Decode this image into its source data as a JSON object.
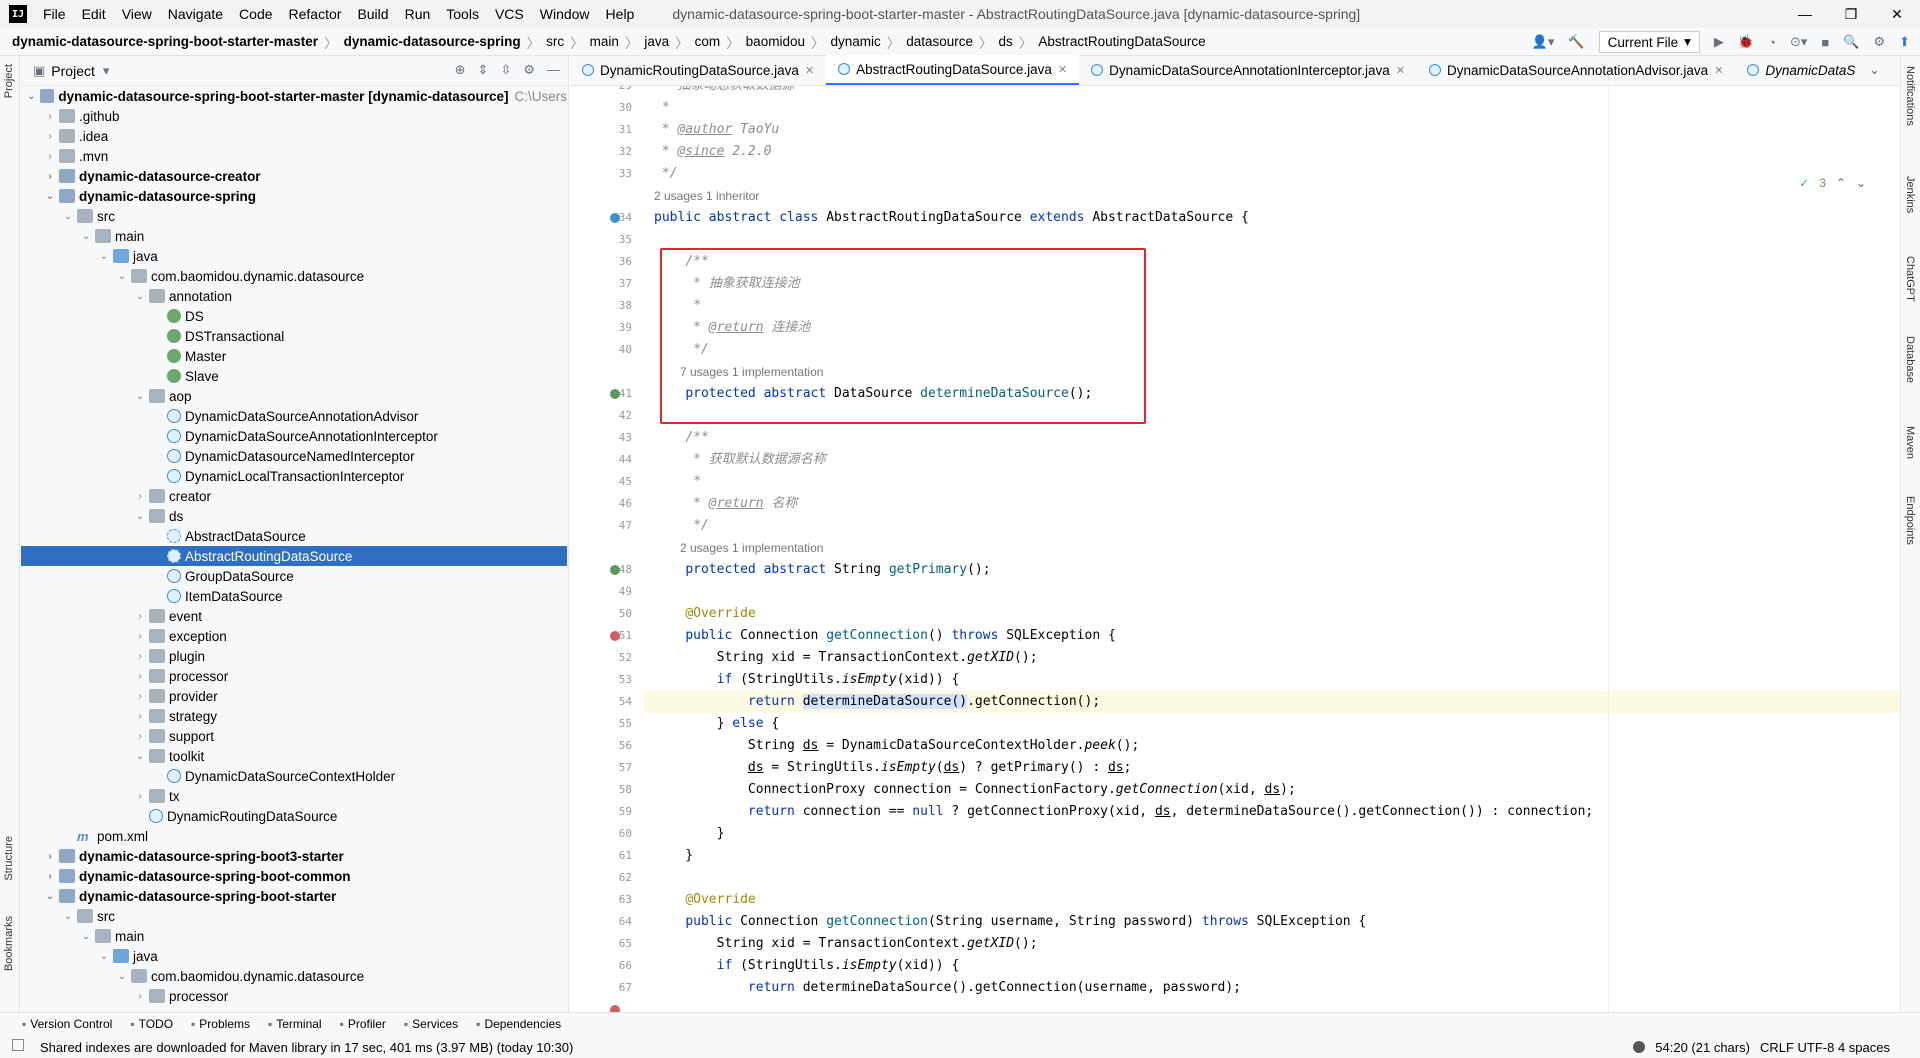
{
  "menubar": {
    "items": [
      "File",
      "Edit",
      "View",
      "Navigate",
      "Code",
      "Refactor",
      "Build",
      "Run",
      "Tools",
      "VCS",
      "Window",
      "Help"
    ],
    "title": "dynamic-datasource-spring-boot-starter-master - AbstractRoutingDataSource.java [dynamic-datasource-spring]"
  },
  "navbar": {
    "crumbs": [
      "dynamic-datasource-spring-boot-starter-master",
      "dynamic-datasource-spring",
      "src",
      "main",
      "java",
      "com",
      "baomidou",
      "dynamic",
      "datasource",
      "ds",
      "AbstractRoutingDataSource"
    ],
    "run_config": "Current File"
  },
  "project": {
    "title": "Project",
    "root": "dynamic-datasource-spring-boot-starter-master [dynamic-datasource]",
    "root_path": "C:\\Users"
  },
  "tree": [
    {
      "label": ".github",
      "type": "folder",
      "level": 1,
      "arrow": "›"
    },
    {
      "label": ".idea",
      "type": "folder",
      "level": 1,
      "arrow": "›"
    },
    {
      "label": ".mvn",
      "type": "folder",
      "level": 1,
      "arrow": "›"
    },
    {
      "label": "dynamic-datasource-creator",
      "type": "module",
      "level": 1,
      "arrow": "›",
      "bold": true
    },
    {
      "label": "dynamic-datasource-spring",
      "type": "module",
      "level": 1,
      "arrow": "⌄",
      "bold": true
    },
    {
      "label": "src",
      "type": "folder",
      "level": 2,
      "arrow": "⌄"
    },
    {
      "label": "main",
      "type": "folder",
      "level": 3,
      "arrow": "⌄"
    },
    {
      "label": "java",
      "type": "folderblue",
      "level": 4,
      "arrow": "⌄"
    },
    {
      "label": "com.baomidou.dynamic.datasource",
      "type": "folder",
      "level": 5,
      "arrow": "⌄"
    },
    {
      "label": "annotation",
      "type": "folder",
      "level": 6,
      "arrow": "⌄"
    },
    {
      "label": "DS",
      "type": "anno",
      "level": 7,
      "arrow": ""
    },
    {
      "label": "DSTransactional",
      "type": "anno",
      "level": 7,
      "arrow": ""
    },
    {
      "label": "Master",
      "type": "anno",
      "level": 7,
      "arrow": ""
    },
    {
      "label": "Slave",
      "type": "anno",
      "level": 7,
      "arrow": ""
    },
    {
      "label": "aop",
      "type": "folder",
      "level": 6,
      "arrow": "⌄"
    },
    {
      "label": "DynamicDataSourceAnnotationAdvisor",
      "type": "class",
      "level": 7,
      "arrow": ""
    },
    {
      "label": "DynamicDataSourceAnnotationInterceptor",
      "type": "class",
      "level": 7,
      "arrow": ""
    },
    {
      "label": "DynamicDatasourceNamedInterceptor",
      "type": "class",
      "level": 7,
      "arrow": ""
    },
    {
      "label": "DynamicLocalTransactionInterceptor",
      "type": "class",
      "level": 7,
      "arrow": ""
    },
    {
      "label": "creator",
      "type": "folder",
      "level": 6,
      "arrow": "›"
    },
    {
      "label": "ds",
      "type": "folder",
      "level": 6,
      "arrow": "⌄"
    },
    {
      "label": "AbstractDataSource",
      "type": "abs",
      "level": 7,
      "arrow": ""
    },
    {
      "label": "AbstractRoutingDataSource",
      "type": "abs",
      "level": 7,
      "arrow": "",
      "selected": true
    },
    {
      "label": "GroupDataSource",
      "type": "class",
      "level": 7,
      "arrow": ""
    },
    {
      "label": "ItemDataSource",
      "type": "class",
      "level": 7,
      "arrow": ""
    },
    {
      "label": "event",
      "type": "folder",
      "level": 6,
      "arrow": "›"
    },
    {
      "label": "exception",
      "type": "folder",
      "level": 6,
      "arrow": "›"
    },
    {
      "label": "plugin",
      "type": "folder",
      "level": 6,
      "arrow": "›"
    },
    {
      "label": "processor",
      "type": "folder",
      "level": 6,
      "arrow": "›"
    },
    {
      "label": "provider",
      "type": "folder",
      "level": 6,
      "arrow": "›"
    },
    {
      "label": "strategy",
      "type": "folder",
      "level": 6,
      "arrow": "›"
    },
    {
      "label": "support",
      "type": "folder",
      "level": 6,
      "arrow": "›"
    },
    {
      "label": "toolkit",
      "type": "folder",
      "level": 6,
      "arrow": "⌄"
    },
    {
      "label": "DynamicDataSourceContextHolder",
      "type": "class",
      "level": 7,
      "arrow": ""
    },
    {
      "label": "tx",
      "type": "folder",
      "level": 6,
      "arrow": "›"
    },
    {
      "label": "DynamicRoutingDataSource",
      "type": "class",
      "level": 6,
      "arrow": ""
    },
    {
      "label": "pom.xml",
      "type": "xml",
      "level": 2,
      "arrow": ""
    },
    {
      "label": "dynamic-datasource-spring-boot3-starter",
      "type": "module",
      "level": 1,
      "arrow": "›",
      "bold": true
    },
    {
      "label": "dynamic-datasource-spring-boot-common",
      "type": "module",
      "level": 1,
      "arrow": "›",
      "bold": true
    },
    {
      "label": "dynamic-datasource-spring-boot-starter",
      "type": "module",
      "level": 1,
      "arrow": "⌄",
      "bold": true
    },
    {
      "label": "src",
      "type": "folder",
      "level": 2,
      "arrow": "⌄"
    },
    {
      "label": "main",
      "type": "folder",
      "level": 3,
      "arrow": "⌄"
    },
    {
      "label": "java",
      "type": "folderblue",
      "level": 4,
      "arrow": "⌄"
    },
    {
      "label": "com.baomidou.dynamic.datasource",
      "type": "folder",
      "level": 5,
      "arrow": "⌄"
    },
    {
      "label": "processor",
      "type": "folder",
      "level": 6,
      "arrow": "›"
    }
  ],
  "tabs": [
    {
      "label": "DynamicRoutingDataSource.java",
      "active": false
    },
    {
      "label": "AbstractRoutingDataSource.java",
      "active": true
    },
    {
      "label": "DynamicDataSourceAnnotationInterceptor.java",
      "active": false
    },
    {
      "label": "DynamicDataSourceAnnotationAdvisor.java",
      "active": false
    },
    {
      "label": "DynamicDataS",
      "active": false
    }
  ],
  "inspection": {
    "count": "3"
  },
  "code_lines": [
    {
      "n": "29",
      "html": "<span class=\"cm\"> * 抽象动态获取数据源</span>"
    },
    {
      "n": "30",
      "html": "<span class=\"cm\"> *</span>"
    },
    {
      "n": "31",
      "html": "<span class=\"cm\"> * <span class=\"tag\">@author</span> TaoYu</span>"
    },
    {
      "n": "32",
      "html": "<span class=\"cm\"> * <span class=\"tag\">@since</span> 2.2.0</span>"
    },
    {
      "n": "33",
      "html": "<span class=\"cm\"> */</span>"
    },
    {
      "n": "",
      "hint": "2 usages    1 inheritor"
    },
    {
      "n": "34",
      "html": "<span class=\"kw\">public abstract class</span> AbstractRoutingDataSource <span class=\"kw\">extends</span> AbstractDataSource {"
    },
    {
      "n": "35",
      "html": ""
    },
    {
      "n": "36",
      "html": "    <span class=\"cm\">/**</span>"
    },
    {
      "n": "37",
      "html": "<span class=\"cm\">     * 抽象获取连接池</span>"
    },
    {
      "n": "38",
      "html": "<span class=\"cm\">     *</span>"
    },
    {
      "n": "39",
      "html": "<span class=\"cm\">     * <span class=\"tag\">@return</span> 连接池</span>"
    },
    {
      "n": "40",
      "html": "<span class=\"cm\">     */</span>"
    },
    {
      "n": "",
      "hint": "7 usages    1 implementation",
      "indent": true
    },
    {
      "n": "41",
      "html": "    <span class=\"kw\">protected abstract</span> DataSource <span class=\"fn\">determineDataSource</span>();"
    },
    {
      "n": "42",
      "html": ""
    },
    {
      "n": "43",
      "html": "    <span class=\"cm\">/**</span>"
    },
    {
      "n": "44",
      "html": "<span class=\"cm\">     * 获取默认数据源名称</span>"
    },
    {
      "n": "45",
      "html": "<span class=\"cm\">     *</span>"
    },
    {
      "n": "46",
      "html": "<span class=\"cm\">     * <span class=\"tag\">@return</span> 名称</span>"
    },
    {
      "n": "47",
      "html": "<span class=\"cm\">     */</span>"
    },
    {
      "n": "",
      "hint": "2 usages    1 implementation",
      "indent": true
    },
    {
      "n": "48",
      "html": "    <span class=\"kw\">protected abstract</span> String <span class=\"fn\">getPrimary</span>();"
    },
    {
      "n": "49",
      "html": ""
    },
    {
      "n": "50",
      "html": "    <span class=\"an\">@Override</span>"
    },
    {
      "n": "51",
      "html": "    <span class=\"kw\">public</span> Connection <span class=\"fn\">getConnection</span>() <span class=\"kw\">throws</span> SQLException {"
    },
    {
      "n": "52",
      "html": "        String xid = TransactionContext.<span class=\"st\">getXID</span>();"
    },
    {
      "n": "53",
      "html": "        <span class=\"kw\">if</span> (StringUtils.<span class=\"st\">isEmpty</span>(xid)) {"
    },
    {
      "n": "54",
      "html": "            <span class=\"kw\">return</span> <span class=\"sel-word\">determineDataSource()</span>.getConnection();",
      "hl": true
    },
    {
      "n": "55",
      "html": "        } <span class=\"kw\">else</span> {"
    },
    {
      "n": "56",
      "html": "            String <u>ds</u> = DynamicDataSourceContextHolder.<span class=\"st\">peek</span>();"
    },
    {
      "n": "57",
      "html": "            <u>ds</u> = StringUtils.<span class=\"st\">isEmpty</span>(<u>ds</u>) ? getPrimary() : <u>ds</u>;"
    },
    {
      "n": "58",
      "html": "            ConnectionProxy connection = ConnectionFactory.<span class=\"st\">getConnection</span>(xid, <u>ds</u>);"
    },
    {
      "n": "59",
      "html": "            <span class=\"kw\">return</span> connection == <span class=\"kw\">null</span> ? getConnectionProxy(xid, <u>ds</u>, determineDataSource().getConnection()) : connection;"
    },
    {
      "n": "60",
      "html": "        }"
    },
    {
      "n": "61",
      "html": "    }"
    },
    {
      "n": "62",
      "html": ""
    },
    {
      "n": "63",
      "html": "    <span class=\"an\">@Override</span>"
    },
    {
      "n": "64",
      "html": "    <span class=\"kw\">public</span> Connection <span class=\"fn\">getConnection</span>(String username, String password) <span class=\"kw\">throws</span> SQLException {"
    },
    {
      "n": "65",
      "html": "        String xid = TransactionContext.<span class=\"st\">getXID</span>();"
    },
    {
      "n": "66",
      "html": "        <span class=\"kw\">if</span> (StringUtils.<span class=\"st\">isEmpty</span>(xid)) {"
    },
    {
      "n": "67",
      "html": "            <span class=\"kw\">return</span> determineDataSource().getConnection(username, password);"
    }
  ],
  "toolwindows": [
    "Version Control",
    "TODO",
    "Problems",
    "Terminal",
    "Profiler",
    "Services",
    "Dependencies"
  ],
  "status": {
    "message": "Shared indexes are downloaded for Maven library in 17 sec, 401 ms (3.97 MB) (today 10:30)",
    "position": "54:20 (21 chars)",
    "encoding": "CRLF  UTF-8  4 spaces"
  },
  "left_strip": [
    "Project",
    "Structure",
    "Bookmarks"
  ],
  "right_strip": [
    "Notifications",
    "Jenkins",
    "ChatGPT",
    "Database",
    "Maven",
    "Endpoints"
  ],
  "colors": {
    "accent": "#3574f0",
    "selection": "#2e6fc1",
    "redbox": "#e0262b"
  }
}
